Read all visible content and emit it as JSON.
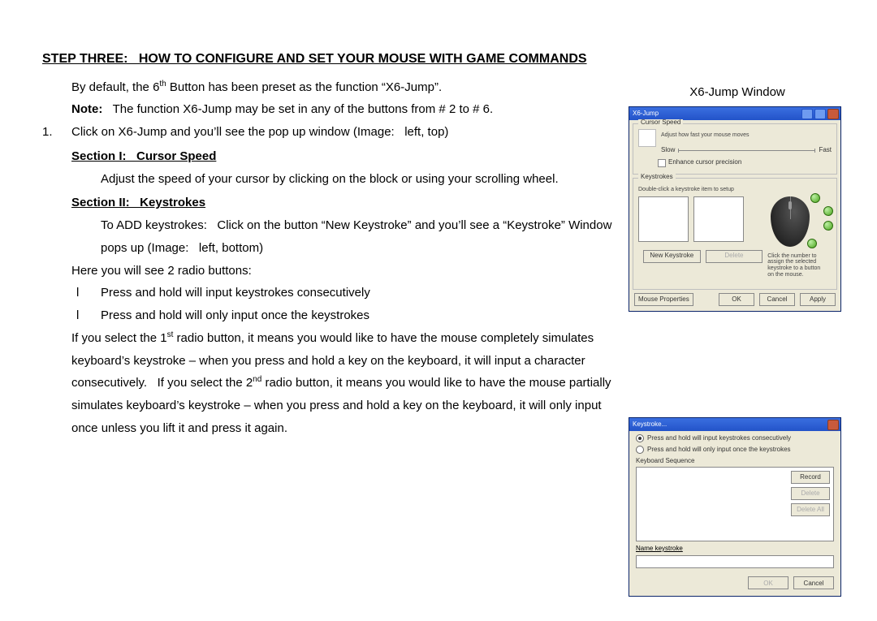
{
  "step_title": "STEP THREE:   HOW TO CONFIGURE AND SET YOUR MOUSE WITH GAME COMMANDS",
  "line_default_a": "By default, the 6",
  "line_default_sup": "th",
  "line_default_b": " Button has been preset as the function “X6-Jump”.",
  "note_label": "Note:",
  "note_body": "The function X6-Jump may be set in any of the buttons from # 2 to # 6.",
  "num1": "1.",
  "num1_body": "Click on X6-Jump and you’ll see the pop up window (Image:   left, top)",
  "section1": "Section I:   Cursor Speed",
  "section1_body": "Adjust the speed of your cursor by clicking on the block or using your scrolling wheel.",
  "section2": "Section II:   Keystrokes",
  "section2_body_a": "To ADD keystrokes:   Click on the button “New Keystroke” and you’ll see a “Keystroke” Window pops up (Image:   left, bottom)",
  "radio_intro": "Here you will see 2 radio buttons:",
  "opt_mark": "l",
  "opt1": "Press and hold will input keystrokes consecutively",
  "opt2": "Press and hold will only input once the keystrokes",
  "tail_a": "If you select the 1",
  "tail_a_sup": "st",
  "tail_b": " radio button, it means you would like to have the mouse completely simulates keyboard’s keystroke – when you press and hold a key on the keyboard, it will input a character consecutively.   If you select the 2",
  "tail_b_sup": "nd",
  "tail_c": " radio button, it means you would like to have the mouse partially simulates keyboard’s keystroke – when you press and hold a key on the keyboard, it will only input once unless you lift it and press it again.",
  "caption": "X6-Jump Window",
  "win1": {
    "title": "X6-Jump",
    "grp_speed": "Cursor Speed",
    "speed_hint": "Adjust how fast your mouse moves",
    "slow": "Slow",
    "fast": "Fast",
    "chk": "Enhance cursor precision",
    "grp_keys": "Keystrokes",
    "keys_hint": "Double-click a keystroke item to setup",
    "newks": "New Keystroke",
    "delks": "Delete",
    "mouse_hint": "Click the number to assign the selected keystroke to a button on the mouse.",
    "mp": "Mouse Properties",
    "ok": "OK",
    "cancel": "Cancel",
    "apply": "Apply"
  },
  "win2": {
    "title": "Keystroke...",
    "r1": "Press and hold will input keystrokes consecutively",
    "r2": "Press and hold will only input once the keystrokes",
    "seq": "Keyboard Sequence",
    "record": "Record",
    "delete": "Delete",
    "deleteall": "Delete All",
    "name": "Name keystroke",
    "ok": "OK",
    "cancel": "Cancel"
  }
}
